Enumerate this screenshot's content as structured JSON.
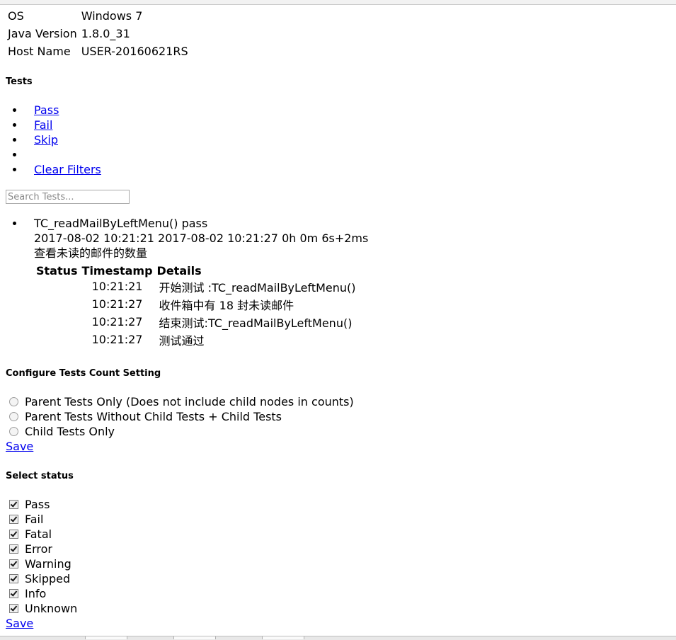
{
  "sysinfo": [
    {
      "key": "OS",
      "value": "Windows 7"
    },
    {
      "key": "Java Version",
      "value": "1.8.0_31"
    },
    {
      "key": "Host Name",
      "value": "USER-20160621RS"
    }
  ],
  "tests_heading": "Tests",
  "filters": {
    "pass": "Pass",
    "fail": "Fail",
    "skip": "Skip",
    "empty": "",
    "clear": "Clear Filters"
  },
  "search": {
    "placeholder": "Search Tests..."
  },
  "test": {
    "name": "TC_readMailByLeftMenu()",
    "status": "pass",
    "start": "2017-08-02 10:21:21",
    "end": "2017-08-02 10:21:27",
    "duration": "0h 0m 6s+2ms",
    "description": "查看未读的邮件的数量",
    "log_headers": {
      "status": "Status",
      "timestamp": "Timestamp",
      "details": "Details"
    },
    "logs": [
      {
        "status": "",
        "timestamp": "10:21:21",
        "details": "开始测试 :TC_readMailByLeftMenu()"
      },
      {
        "status": "",
        "timestamp": "10:21:27",
        "details": "收件箱中有 18 封未读邮件"
      },
      {
        "status": "",
        "timestamp": "10:21:27",
        "details": "结束测试:TC_readMailByLeftMenu()"
      },
      {
        "status": "",
        "timestamp": "10:21:27",
        "details": "测试通过"
      }
    ]
  },
  "count_setting": {
    "heading": "Configure Tests Count Setting",
    "options": [
      "Parent Tests Only (Does not include child nodes in counts)",
      "Parent Tests Without Child Tests + Child Tests",
      "Child Tests Only"
    ],
    "save": "Save"
  },
  "select_status": {
    "heading": "Select status",
    "options": [
      "Pass",
      "Fail",
      "Fatal",
      "Error",
      "Warning",
      "Skipped",
      "Info",
      "Unknown"
    ],
    "checked": [
      true,
      true,
      true,
      true,
      true,
      true,
      true,
      true
    ],
    "save": "Save"
  }
}
